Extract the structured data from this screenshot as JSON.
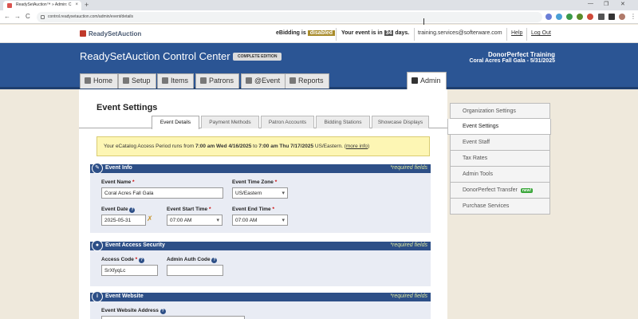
{
  "browser": {
    "tab_title": "ReadySetAuction™ » Admin: C",
    "tab_close": "×",
    "new_tab": "+",
    "url": "control.readysetauction.com/admin/event/details",
    "nav_back": "←",
    "nav_forward": "→",
    "nav_reload": "C",
    "win_minimize": "—",
    "win_restore": "❐",
    "win_close": "✕",
    "menu": "⋮"
  },
  "topbar": {
    "logo": "ReadySetAuction",
    "ebidding_prefix": "eBidding is",
    "ebidding_status": "disabled",
    "event_in_prefix": "Your event is in",
    "event_days": "34",
    "event_in_suffix": "days.",
    "user_email": "training.services@softerware.com",
    "help": "Help",
    "logout": "Log Out"
  },
  "header": {
    "title": "ReadySetAuction Control Center",
    "edition": "COMPLETE EDITION",
    "org_name": "DonorPerfect Training",
    "event_name": "Coral Acres Fall Gala - 5/31/2025"
  },
  "nav_tabs": [
    {
      "label": "Home"
    },
    {
      "label": "Setup"
    },
    {
      "label": "Items"
    },
    {
      "label": "Patrons"
    },
    {
      "label": "@Event"
    },
    {
      "label": "Reports"
    },
    {
      "label": "Admin"
    }
  ],
  "page": {
    "title": "Event Settings",
    "subtabs": [
      {
        "label": "Event Details"
      },
      {
        "label": "Payment Methods"
      },
      {
        "label": "Patron Accounts"
      },
      {
        "label": "Bidding Stations"
      },
      {
        "label": "Showcase Displays"
      }
    ],
    "notice": {
      "p1": "Your eCatalog Access Period runs from ",
      "start": "7:00 am Wed 4/16/2025",
      "p2": " to ",
      "end": "7:00 am Thu 7/17/2025",
      "p3": " US/Eastern. (",
      "more": "more info",
      "p4": ")"
    }
  },
  "sections": {
    "event_info": {
      "title": "Event Info",
      "required": "*required fields",
      "event_name_label": "Event Name",
      "event_name_value": "Coral Acres Fall Gala",
      "time_zone_label": "Event Time Zone",
      "time_zone_value": "US/Eastern",
      "event_date_label": "Event Date",
      "event_date_value": "2025-05-31",
      "start_time_label": "Event Start Time",
      "start_time_value": "07:00 AM",
      "end_time_label": "Event End Time",
      "end_time_value": "07:00 AM"
    },
    "access_security": {
      "title": "Event Access Security",
      "required": "*required fields",
      "access_code_label": "Access Code",
      "access_code_value": "SrXfyqLc",
      "admin_auth_label": "Admin Auth Code",
      "admin_auth_value": ""
    },
    "website": {
      "title": "Event Website",
      "required": "*required fields",
      "address_label": "Event Website Address"
    }
  },
  "admin_menu": [
    {
      "label": "Organization Settings"
    },
    {
      "label": "Event Settings"
    },
    {
      "label": "Event Staff"
    },
    {
      "label": "Tax Rates"
    },
    {
      "label": "Admin Tools"
    },
    {
      "label": "DonorPerfect Transfer",
      "badge": "new!"
    },
    {
      "label": "Purchase Services"
    }
  ],
  "colors": {
    "header_blue": "#2b5594",
    "section_blue": "#2d4f87",
    "notice_yellow": "#fdf6b4",
    "disabled_badge": "#a88b2a",
    "new_badge": "#3aa63a"
  }
}
